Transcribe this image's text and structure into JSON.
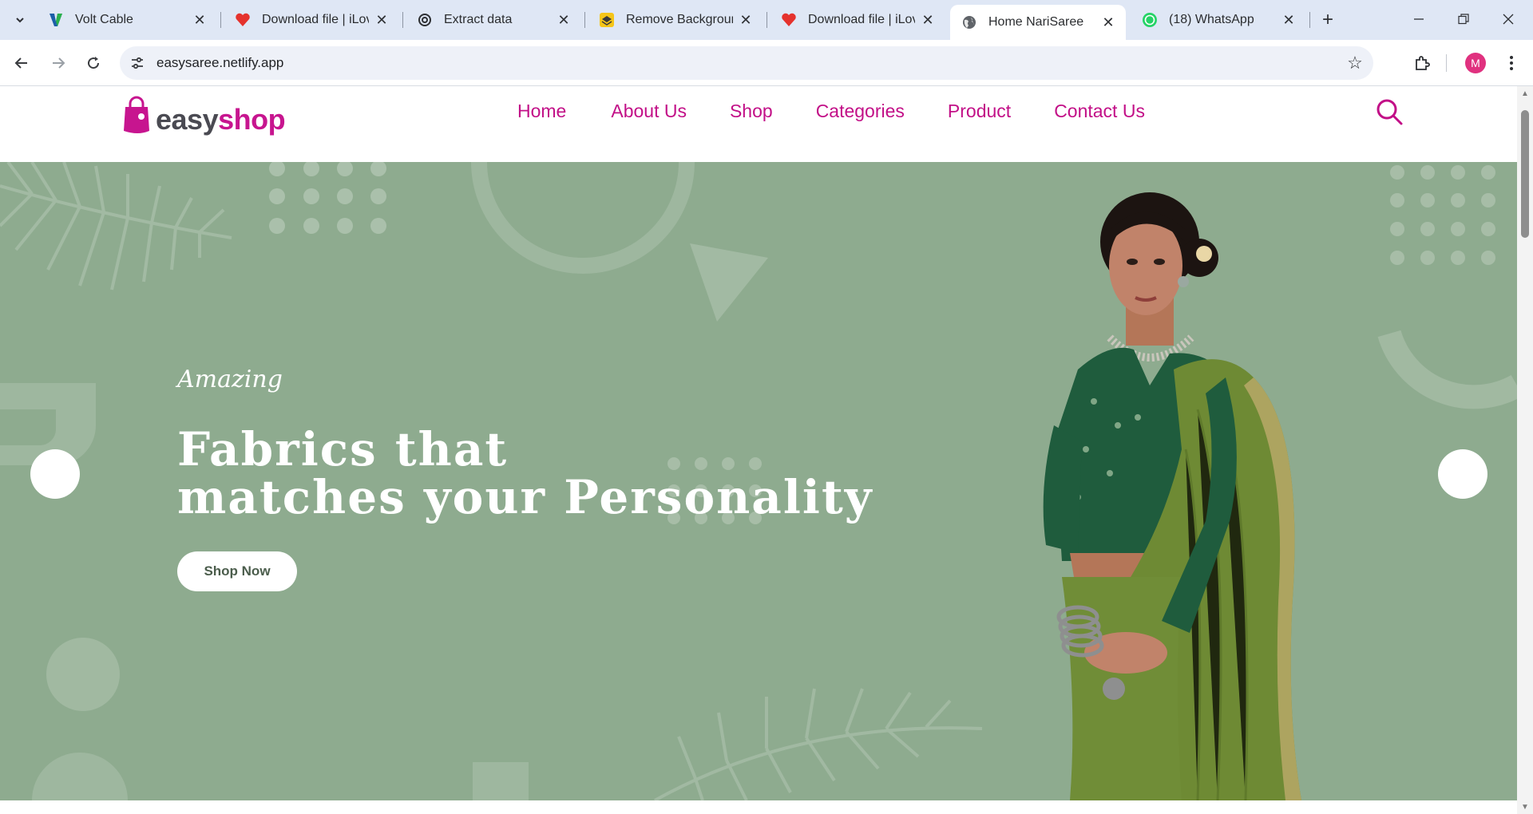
{
  "browser": {
    "tabs": [
      {
        "title": "Volt Cable",
        "icon": "volt-v-icon",
        "active": false
      },
      {
        "title": "Download file | iLove",
        "icon": "ilove-heart-icon",
        "active": false
      },
      {
        "title": "Extract data",
        "icon": "openai-icon",
        "active": false
      },
      {
        "title": "Remove Background",
        "icon": "remove-bg-icon",
        "active": false
      },
      {
        "title": "Download file | iLove",
        "icon": "ilove-heart-icon",
        "active": false
      },
      {
        "title": "Home NariSaree",
        "icon": "globe-icon",
        "active": true
      },
      {
        "title": "(18) WhatsApp",
        "icon": "whatsapp-icon",
        "active": false
      }
    ],
    "url": "easysaree.netlify.app",
    "profile_initial": "M"
  },
  "site": {
    "logo": {
      "part1": "easy",
      "part2": "shop"
    },
    "nav": [
      "Home",
      "About Us",
      "Shop",
      "Categories",
      "Product",
      "Contact Us"
    ],
    "hero": {
      "eyebrow": "Amazing",
      "title_line1": "Fabrics that",
      "title_line2": "matches your Personality",
      "cta": "Shop Now"
    },
    "colors": {
      "brand": "#c20f87",
      "hero_bg": "#8eab8f",
      "saree": "#6e8a34",
      "blouse": "#1f5c3d"
    }
  }
}
